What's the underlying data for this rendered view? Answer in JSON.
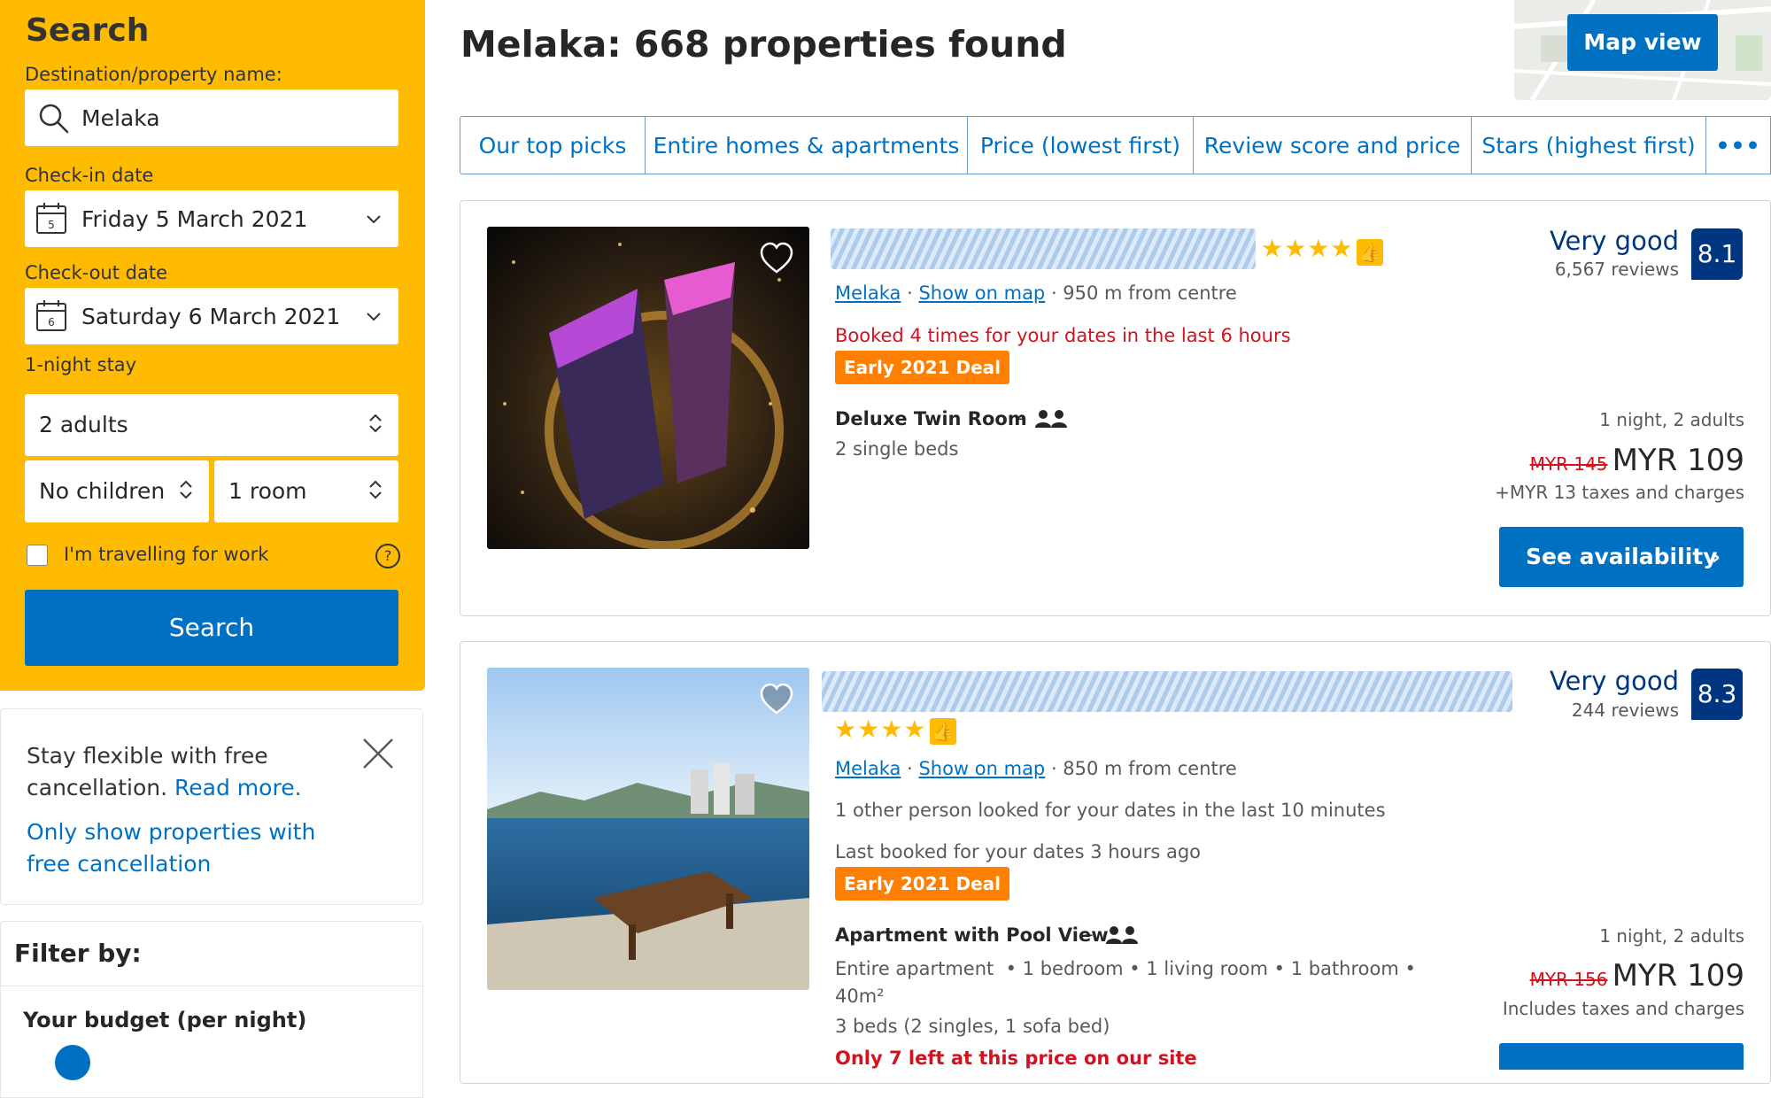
{
  "search": {
    "title": "Search",
    "destination_label": "Destination/property name:",
    "destination_value": "Melaka",
    "checkin_label": "Check-in date",
    "checkin_value": "Friday 5 March 2021",
    "checkin_day": "5",
    "checkout_label": "Check-out date",
    "checkout_value": "Saturday 6 March 2021",
    "checkout_day": "6",
    "stay_length": "1-night stay",
    "adults": "2 adults",
    "children": "No children",
    "rooms": "1 room",
    "work_label": "I'm travelling for work",
    "help_glyph": "?",
    "search_button": "Search"
  },
  "flexible": {
    "text": "Stay flexible with free cancellation.",
    "read_more": "Read more.",
    "only_free_link": "Only show properties with free cancellation"
  },
  "filter": {
    "title": "Filter by:",
    "budget_label": "Your budget (per night)"
  },
  "header": {
    "title": "Melaka: 668 properties found",
    "map_button": "Map view"
  },
  "sort_tabs": [
    "Our top picks",
    "Entire homes & apartments",
    "Price (lowest first)",
    "Review score and price",
    "Stars (highest first)",
    "•••"
  ],
  "properties": [
    {
      "stars": "★★★★",
      "city": "Melaka",
      "show_on_map": "Show on map",
      "distance": "950 m from centre",
      "notice_1": "Booked 4 times for your dates in the last 6 hours",
      "notice_2": "",
      "deal": "Early 2021 Deal",
      "room_type": "Deluxe Twin Room",
      "room_details": "2 single beds",
      "room_details_2": "",
      "rating_word": "Very good",
      "reviews": "6,567 reviews",
      "score": "8.1",
      "price_meta": "1 night, 2 adults",
      "old_price": "MYR 145",
      "new_price": "MYR 109",
      "taxes": "+MYR 13 taxes and charges",
      "button": "See availability"
    },
    {
      "stars": "★★★★",
      "city": "Melaka",
      "show_on_map": "Show on map",
      "distance": "850 m from centre",
      "notice_1": "1 other person looked for your dates in the last 10 minutes",
      "notice_2": "Last booked for your dates 3 hours ago",
      "deal": "Early 2021 Deal",
      "room_type": "Apartment with Pool View",
      "room_details": "Entire apartment  • 1 bedroom • 1 living room • 1 bathroom •",
      "room_details_2": "40m²",
      "beds": "3 beds (2 singles, 1 sofa bed)",
      "scarcity": "Only 7 left at this price on our site",
      "rating_word": "Very good",
      "reviews": "244 reviews",
      "score": "8.3",
      "price_meta": "1 night, 2 adults",
      "old_price": "MYR 156",
      "new_price": "MYR 109",
      "taxes": "Includes taxes and charges"
    }
  ]
}
